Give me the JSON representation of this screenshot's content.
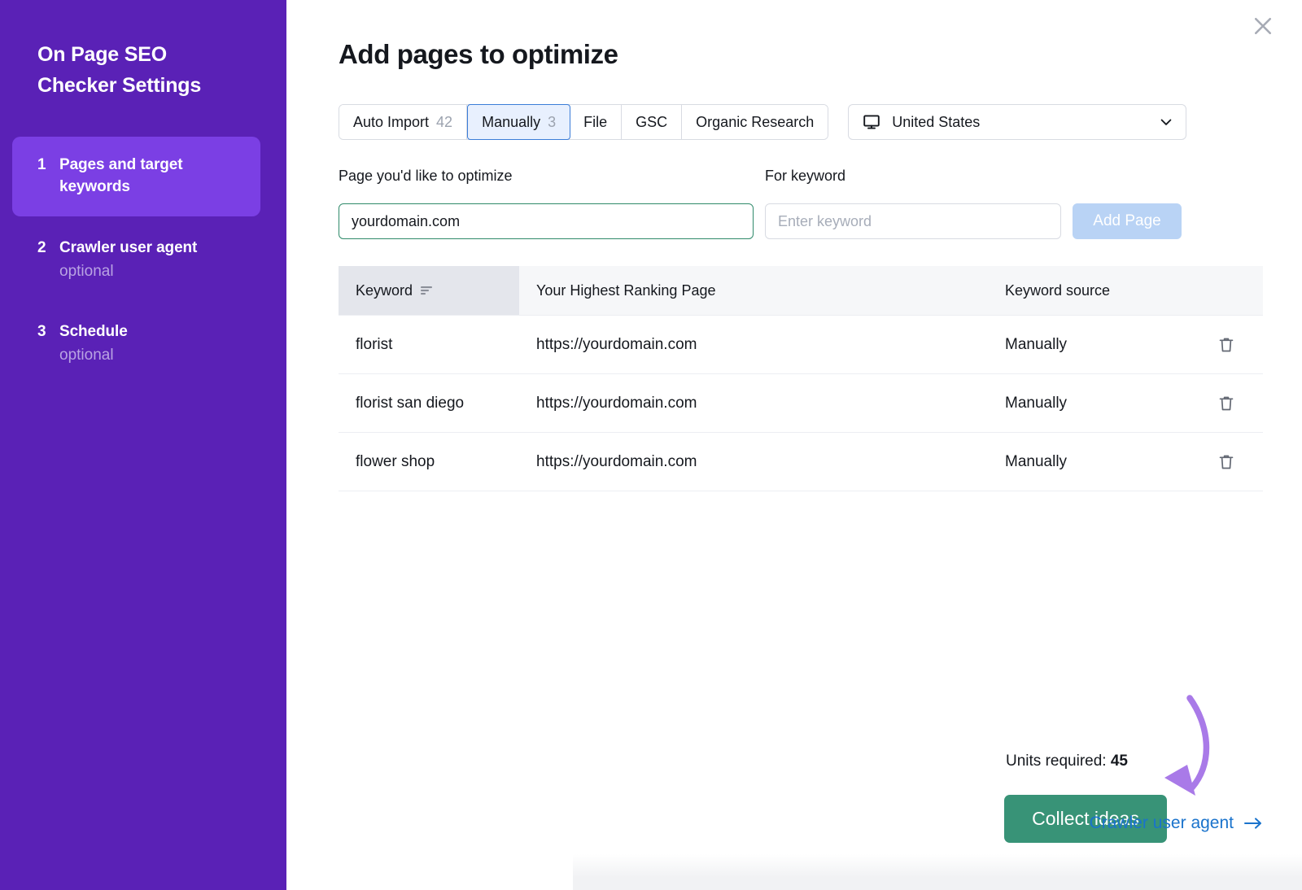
{
  "sidebar": {
    "title": "On Page SEO\nChecker Settings",
    "steps": [
      {
        "num": "1",
        "label": "Pages and target keywords",
        "sub": ""
      },
      {
        "num": "2",
        "label": "Crawler user agent",
        "sub": "optional"
      },
      {
        "num": "3",
        "label": "Schedule",
        "sub": "optional"
      }
    ]
  },
  "header": {
    "title": "Add pages to optimize",
    "close_icon": "close-icon"
  },
  "tabs": [
    {
      "label": "Auto Import",
      "count": "42",
      "selected": false
    },
    {
      "label": "Manually",
      "count": "3",
      "selected": true
    },
    {
      "label": "File",
      "count": "",
      "selected": false
    },
    {
      "label": "GSC",
      "count": "",
      "selected": false
    },
    {
      "label": "Organic Research",
      "count": "",
      "selected": false
    }
  ],
  "country_select": {
    "icon": "monitor-icon",
    "value": "United States",
    "chevron": "chevron-down-icon"
  },
  "form": {
    "page_label": "Page you'd like to optimize",
    "keyword_label": "For keyword",
    "page_value": "yourdomain.com",
    "keyword_placeholder": "Enter keyword",
    "add_page_label": "Add Page"
  },
  "table": {
    "columns": [
      "Keyword",
      "Your Highest Ranking Page",
      "Keyword source"
    ],
    "sort_icon": "sort-descending-icon",
    "delete_icon": "trash-icon",
    "rows": [
      {
        "keyword": "florist",
        "page": "https://yourdomain.com",
        "source": "Manually"
      },
      {
        "keyword": "florist san diego",
        "page": "https://yourdomain.com",
        "source": "Manually"
      },
      {
        "keyword": "flower shop",
        "page": "https://yourdomain.com",
        "source": "Manually"
      }
    ]
  },
  "footer": {
    "units_label": "Units required:",
    "units_value": "45",
    "collect_label": "Collect ideas",
    "crawler_link": "Crawler user agent",
    "crawler_arrow": "arrow-right-icon"
  },
  "colors": {
    "sidebar_bg": "#5a21b6",
    "sidebar_active": "#7b3fe4",
    "accent_green": "#389377",
    "link_blue": "#1a73cc",
    "tab_selected_bg": "#e8f0fe",
    "tab_selected_border": "#3b7dd8",
    "annotation_purple": "#a97ae8",
    "input_valid_border": "#2f8a6a"
  }
}
